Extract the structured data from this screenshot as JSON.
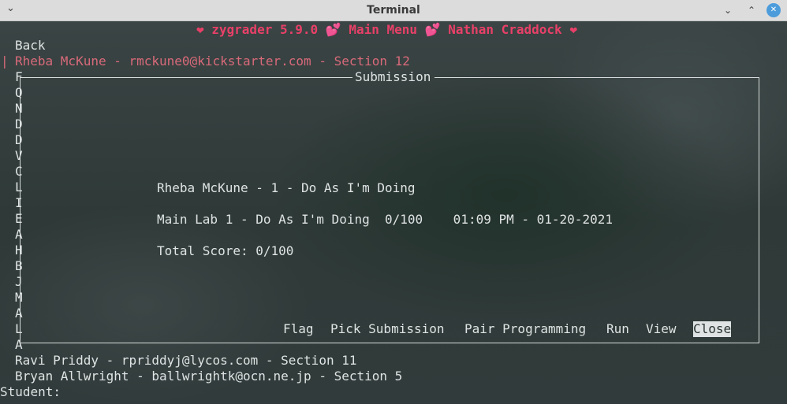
{
  "window": {
    "title": "Terminal"
  },
  "header": {
    "text": "❤ zygrader 5.9.0 💕 Main Menu 💕 Nathan Craddock ❤"
  },
  "menu": {
    "back_label": "Back",
    "selected_bar": "|",
    "selected_student": "Rheba McKune - rmckune0@kickstarter.com - Section 12",
    "partial_letters": [
      "F",
      "Q",
      "N",
      "D",
      "D",
      "V",
      "C",
      "L",
      "I",
      "E",
      "A",
      "H",
      "B",
      "J",
      "M",
      "A",
      "L",
      "A"
    ],
    "after_students": [
      "Ravi Priddy - rpriddyj@lycos.com - Section 11",
      "Bryan Allwright - ballwrightk@ocn.ne.jp - Section 5"
    ],
    "prompt": "Student:"
  },
  "dialog": {
    "title": "Submission",
    "heading": "Rheba McKune - 1 - Do As I'm Doing",
    "lab_line": "Main Lab 1 - Do As I'm Doing  0/100    01:09 PM - 01-20-2021",
    "total": "Total Score: 0/100",
    "buttons": {
      "flag": "Flag",
      "pick": "Pick Submission",
      "pair": "Pair Programming",
      "run": "Run",
      "view": "View",
      "close": "Close"
    }
  }
}
